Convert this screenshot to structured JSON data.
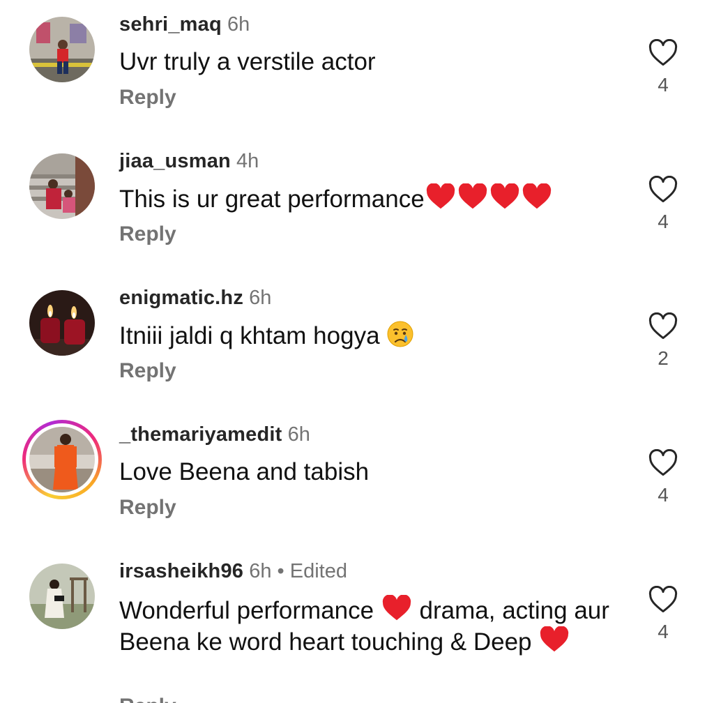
{
  "comments": [
    {
      "username": "sehri_maq",
      "time": "6h",
      "text": "Uvr truly a verstile actor",
      "reply_label": "Reply",
      "likes": "4"
    },
    {
      "username": "jiaa_usman",
      "time": "4h",
      "text": "This is ur great performance",
      "reply_label": "Reply",
      "likes": "4"
    },
    {
      "username": "enigmatic.hz",
      "time": "6h",
      "text": "Itniii jaldi q khtam hogya ",
      "reply_label": "Reply",
      "likes": "2"
    },
    {
      "username": "_themariyamedit",
      "time": "6h",
      "text": "Love Beena and tabish",
      "reply_label": "Reply",
      "likes": "4",
      "has_story_ring": true
    },
    {
      "username": "irsasheikh96",
      "time": "6h",
      "edited": "Edited",
      "separator": "•",
      "text_part1": "Wonderful performance ",
      "text_part2": " drama, acting aur Beena ke word heart touching & Deep ",
      "reply_label": "Reply",
      "likes": "4"
    }
  ],
  "icons": {
    "like": "heart-outline-icon",
    "emoji_heart": "red-heart-emoji",
    "emoji_cry": "crying-face-emoji"
  },
  "colors": {
    "username": "#262626",
    "secondary": "#737373",
    "heart_emoji": "#e8202b",
    "story_ring_start": "#f9ce34",
    "story_ring_mid": "#ee2a7b"
  }
}
